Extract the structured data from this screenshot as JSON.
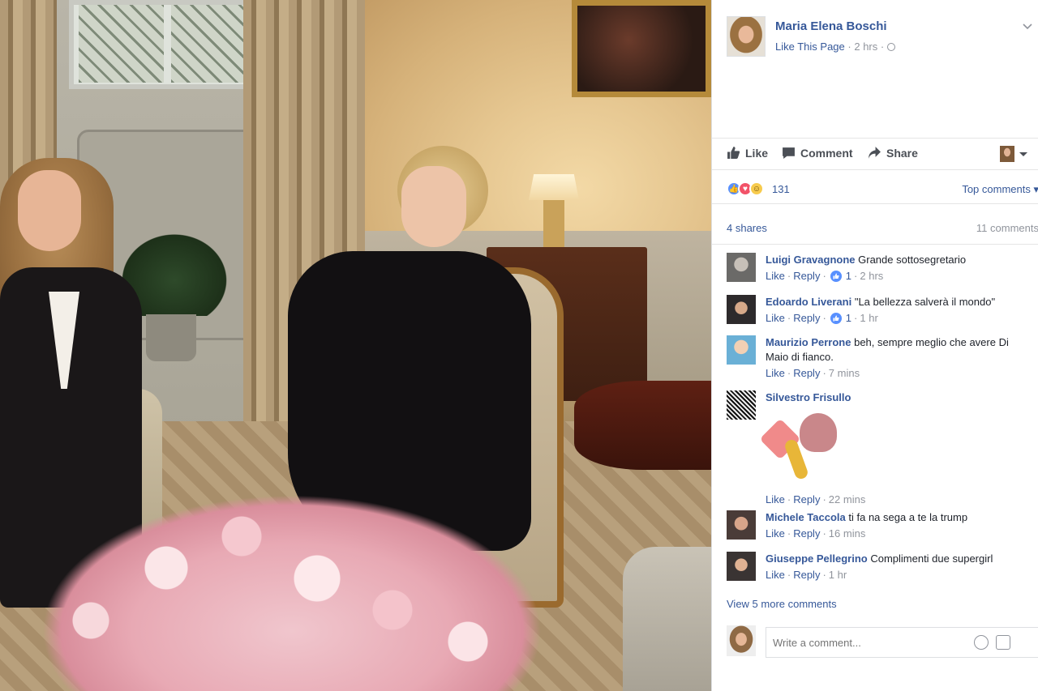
{
  "post": {
    "page_name": "Maria Elena Boschi",
    "like_page": "Like This Page",
    "time": "2 hrs",
    "separator": "·"
  },
  "actions": {
    "like": "Like",
    "comment": "Comment",
    "share": "Share"
  },
  "reactions": {
    "count": "131",
    "sort": "Top comments"
  },
  "counts": {
    "shares": "4 shares",
    "comments": "11 comments"
  },
  "comments": [
    {
      "author": "Luigi Gravagnone",
      "text": "Grande sottosegretario",
      "like": "Like",
      "reply": "Reply",
      "likes": "1",
      "time": "2 hrs"
    },
    {
      "author": "Edoardo Liverani",
      "text": "\"La bellezza salverà il mondo\"",
      "like": "Like",
      "reply": "Reply",
      "likes": "1",
      "time": "1 hr"
    },
    {
      "author": "Maurizio Perrone",
      "text": "beh, sempre meglio che avere Di Maio di fianco.",
      "like": "Like",
      "reply": "Reply",
      "time": "7 mins"
    },
    {
      "author": "Silvestro Frisullo",
      "text": "",
      "like": "Like",
      "reply": "Reply",
      "time": "22 mins"
    },
    {
      "author": "Michele Taccola",
      "text": "ti fa na sega a te la trump",
      "like": "Like",
      "reply": "Reply",
      "time": "16 mins"
    },
    {
      "author": "Giuseppe Pellegrino",
      "text": "Complimenti due supergirl",
      "like": "Like",
      "reply": "Reply",
      "time": "1 hr"
    }
  ],
  "view_more": "View 5 more comments",
  "write_placeholder": "Write a comment...",
  "colors": {
    "link": "#365899",
    "muted": "#90949c",
    "like_blue": "#5890ff",
    "love_red": "#f25268"
  }
}
